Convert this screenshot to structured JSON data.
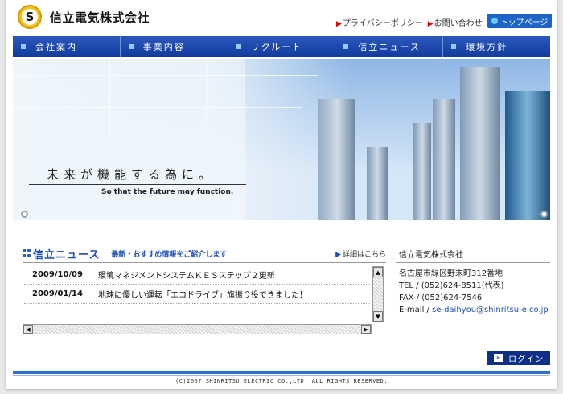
{
  "header": {
    "company_name": "信立電気株式会社",
    "logo_letter": "S",
    "links": [
      {
        "label": "プライバシーポリシー"
      },
      {
        "label": "お問い合わせ"
      }
    ],
    "top_button": "トップページ"
  },
  "nav": {
    "items": [
      {
        "label": "会社案内"
      },
      {
        "label": "事業内容"
      },
      {
        "label": "リクルート"
      },
      {
        "label": "信立ニュース"
      },
      {
        "label": "環境方針"
      }
    ]
  },
  "hero": {
    "tagline_jp": "未来が機能する為に。",
    "tagline_en": "So that the future may function."
  },
  "news": {
    "title": "信立ニュース",
    "subtitle": "最新・おすすめ情報をご紹介します",
    "more_link": "詳細はこちら",
    "items": [
      {
        "date": "2009/10/09",
        "text": "環境マネジメントシステムＫＥＳステップ２更新"
      },
      {
        "date": "2009/01/14",
        "text": "地球に優しい運転「エコドライブ」旗振り役できました！"
      }
    ]
  },
  "company": {
    "title": "信立電気株式会社",
    "address": "名古屋市緑区野末町312番地",
    "tel": "TEL / (052)624-8511(代表)",
    "fax": "FAX / (052)624-7546",
    "email_label": "E-mail / ",
    "email": "se-daihyou@shinritsu-e.co.jp"
  },
  "login": {
    "label": "ログイン",
    "arrow": "»"
  },
  "footer": {
    "copyright": "(C)2007 SHINRITSU ELECTRIC CO.,LTD. ALL RIGHTS RESERVED."
  },
  "colors": {
    "brand_blue": "#0d2f86",
    "accent_blue": "#1b64c8",
    "link_red": "#d90000"
  }
}
